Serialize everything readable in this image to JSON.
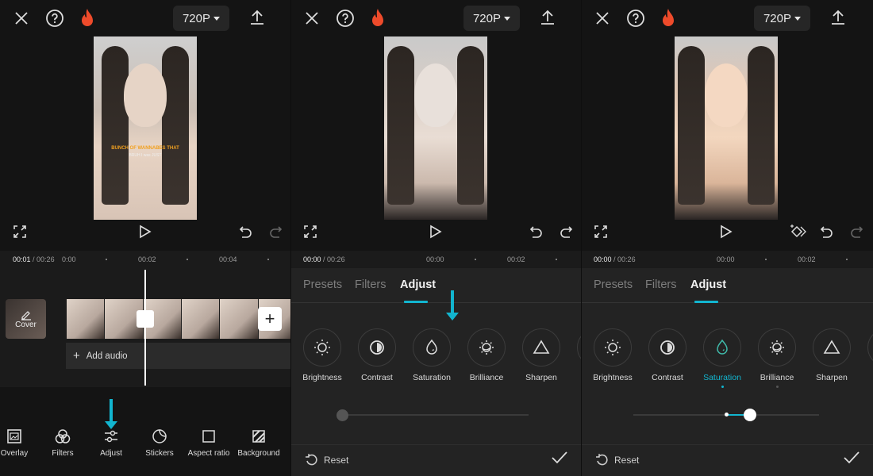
{
  "common": {
    "resolution": "720P",
    "tabs": [
      "Presets",
      "Filters",
      "Adjust"
    ],
    "active_tab": "Adjust",
    "reset_label": "Reset",
    "accent_color": "#12b5cf",
    "icons": {
      "close": "close-icon",
      "help": "help-icon",
      "flame": "flame-icon",
      "export": "export-icon",
      "fullscreen": "fullscreen-icon",
      "play": "play-icon",
      "undo": "undo-icon",
      "redo": "redo-icon",
      "keyframe": "keyframe-icon",
      "reset": "reset-icon",
      "confirm": "checkmark-icon"
    }
  },
  "panel1": {
    "current_time": "00:01",
    "total_time": "00:26",
    "ticks": [
      "0:00",
      "00:02",
      "00:04"
    ],
    "video_caption": "BUNCH OF WANNABES THAT",
    "video_subcaption": "BRUH I was JUST",
    "cover_label": "Cover",
    "add_audio_label": "Add audio",
    "add_clip_label": "+",
    "toolbar": [
      {
        "label": "Overlay",
        "icon": "overlay-icon"
      },
      {
        "label": "Filters",
        "icon": "filters-icon"
      },
      {
        "label": "Adjust",
        "icon": "adjust-icon"
      },
      {
        "label": "Stickers",
        "icon": "stickers-icon"
      },
      {
        "label": "Aspect ratio",
        "icon": "aspect-ratio-icon"
      },
      {
        "label": "Background",
        "icon": "background-icon"
      }
    ]
  },
  "panel2": {
    "current_time": "00:00",
    "total_time": "00:26",
    "ticks": [
      "00:00",
      "00:02"
    ],
    "adjust_options": [
      {
        "label": "Brightness",
        "icon": "brightness-icon"
      },
      {
        "label": "Contrast",
        "icon": "contrast-icon"
      },
      {
        "label": "Saturation",
        "icon": "saturation-icon"
      },
      {
        "label": "Brilliance",
        "icon": "brilliance-icon"
      },
      {
        "label": "Sharpen",
        "icon": "sharpen-icon"
      }
    ],
    "slider_value_fraction": 0.0
  },
  "panel3": {
    "current_time": "00:00",
    "total_time": "00:26",
    "ticks": [
      "00:00",
      "00:02"
    ],
    "selected_option": "Saturation",
    "adjust_options": [
      {
        "label": "Brightness",
        "icon": "brightness-icon"
      },
      {
        "label": "Contrast",
        "icon": "contrast-icon"
      },
      {
        "label": "Saturation",
        "icon": "saturation-icon",
        "selected": true,
        "modified": true
      },
      {
        "label": "Brilliance",
        "icon": "brilliance-icon",
        "modified": true
      },
      {
        "label": "Sharpen",
        "icon": "sharpen-icon"
      }
    ],
    "slider_center_fraction": 0.5,
    "slider_value_fraction": 0.63
  }
}
